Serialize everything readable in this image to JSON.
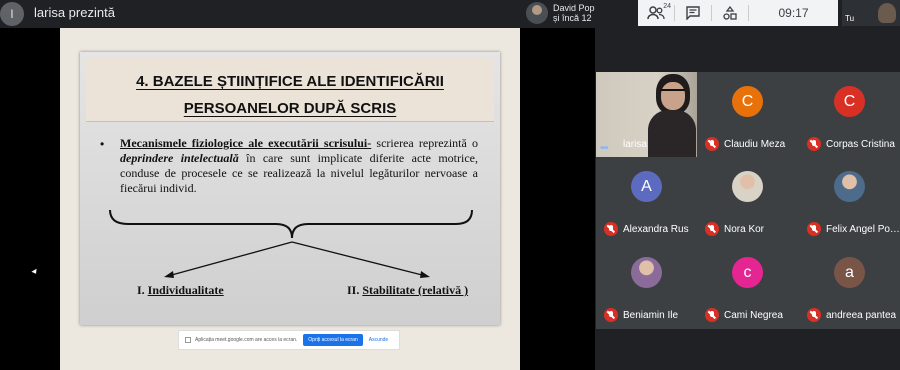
{
  "presenter": {
    "initial": "l",
    "label": "larisa prezintă"
  },
  "speaker": {
    "line1": "David Pop",
    "line2": "și încă 12"
  },
  "toolbar": {
    "participants_icon": "people-icon",
    "participants_count": "24",
    "chat_icon": "chat-icon",
    "activities_icon": "activities-icon",
    "time": "09:17"
  },
  "self_view": {
    "label": "Tu"
  },
  "slide": {
    "title_line1": "4. BAZELE  ȘTIINȚIFICE ALE IDENTIFICĂRII",
    "title_line2": "PERSOANELOR DUPĂ SCRIS",
    "bullet": "•",
    "text_bold": "Mecanismele fiziologice ale executării scrisului-",
    "text_part1": " scrierea reprezintă o ",
    "text_emph": "deprindere intelectuală",
    "text_part2": " în care sunt implicate diferite acte motrice, conduse de procesele ce se realizează la nivelul legăturilor nervoase a fiecărui individ.",
    "left_prefix": "I. ",
    "left_label": "Individualitate",
    "right_prefix": "II. ",
    "right_label": "Stabilitate (relativă )"
  },
  "share_bar": {
    "message": "Aplicația meet.google.com are acces la ecran.",
    "stop_label": "Opriți accesul la ecran",
    "hide_label": "Ascunde"
  },
  "participants": [
    {
      "name": "larisa",
      "initial": "",
      "color": "",
      "video": true,
      "muted": false
    },
    {
      "name": "Claudiu Meza",
      "initial": "C",
      "color": "#e8710a",
      "muted": true
    },
    {
      "name": "Corpas Cristina",
      "initial": "C",
      "color": "#d93025",
      "muted": true
    },
    {
      "name": "Alexandra Rus",
      "initial": "A",
      "color": "#5c6bc0",
      "muted": true
    },
    {
      "name": "Nora Kor",
      "initial": "",
      "color": "#d9d2c6",
      "photo": true,
      "muted": true
    },
    {
      "name": "Felix Angel Po…",
      "initial": "",
      "color": "#4d6b8a",
      "photo": true,
      "muted": true
    },
    {
      "name": "Beniamin Ile",
      "initial": "",
      "color": "#8a6b9a",
      "photo": true,
      "muted": true
    },
    {
      "name": "Cami Negrea",
      "initial": "c",
      "color": "#e52592",
      "muted": true
    },
    {
      "name": "andreea pantea",
      "initial": "a",
      "color": "#795548",
      "muted": true
    }
  ]
}
